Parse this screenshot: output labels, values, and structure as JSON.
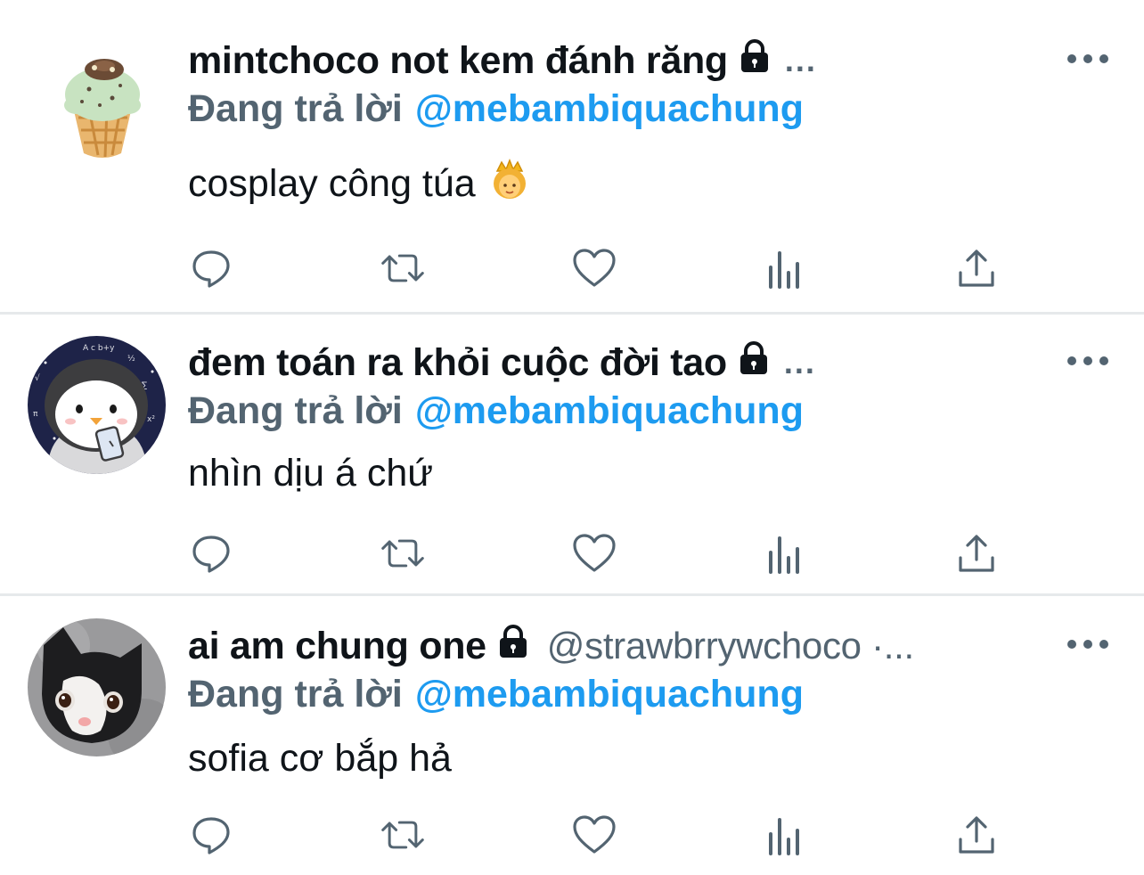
{
  "tweets": [
    {
      "display_name": "mintchoco not kem đánh răng",
      "name_overflow": "...",
      "handle": "",
      "reply_prefix": "Đang trả lời",
      "reply_to": "@mebambiquachung",
      "text": "cosplay công túa",
      "emoji": "princess-emoji",
      "avatar": "ice-cream-avatar"
    },
    {
      "display_name": "đem toán ra khỏi cuộc đời tao",
      "name_overflow": "...",
      "handle": "",
      "reply_prefix": "Đang trả lời",
      "reply_to": "@mebambiquachung",
      "text": "nhìn dịu á chứ",
      "avatar": "penguin-avatar"
    },
    {
      "display_name": "ai am chung one",
      "name_overflow": "",
      "handle": "@strawbrrywchoco ·...",
      "reply_prefix": "Đang trả lời",
      "reply_to": "@mebambiquachung",
      "text": "sofia cơ bắp hả",
      "avatar": "cat-avatar"
    }
  ],
  "actions": [
    "reply-icon",
    "retweet-icon",
    "like-icon",
    "views-icon",
    "share-icon"
  ],
  "colors": {
    "link": "#1d9bf0",
    "secondary": "#536471",
    "text": "#0f1419",
    "divider": "#e6e9eb"
  }
}
